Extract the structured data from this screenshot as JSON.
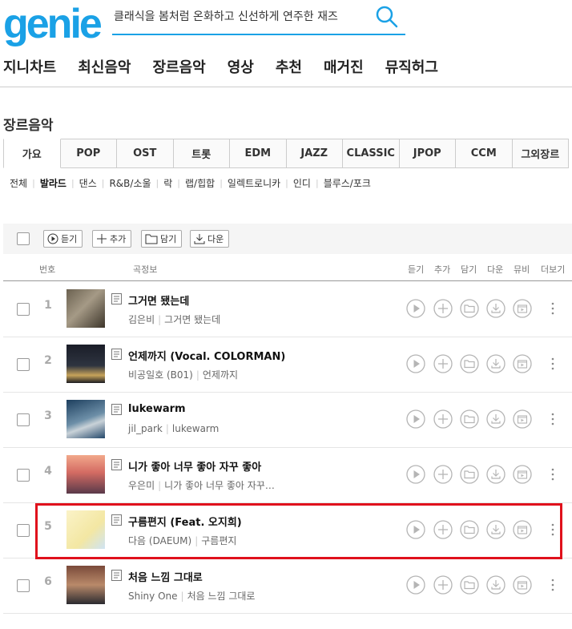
{
  "logo": "genie",
  "search": {
    "value": "클래식을 봄처럼 온화하고 신선하게 연주한 재즈"
  },
  "gnb": [
    "지니차트",
    "최신음악",
    "장르음악",
    "영상",
    "추천",
    "매거진",
    "뮤직허그"
  ],
  "section_title": "장르음악",
  "genre_tabs": [
    "가요",
    "POP",
    "OST",
    "트롯",
    "EDM",
    "JAZZ",
    "CLASSIC",
    "JPOP",
    "CCM",
    "그외장르"
  ],
  "active_tab": "가요",
  "sub_genres": [
    "전체",
    "발라드",
    "댄스",
    "R&B/소울",
    "락",
    "랩/힙합",
    "일렉트로니카",
    "인디",
    "블루스/포크"
  ],
  "active_sub": "발라드",
  "toolbar": {
    "listen": "듣기",
    "add": "추가",
    "save": "담기",
    "download": "다운"
  },
  "columns": {
    "no": "번호",
    "info": "곡정보",
    "listen": "듣기",
    "add": "추가",
    "save": "담기",
    "download": "다운",
    "mv": "뮤비",
    "more": "더보기"
  },
  "songs": [
    {
      "no": "1",
      "title": "그거면 됐는데",
      "artist": "김은비",
      "album": "그거면 됐는데"
    },
    {
      "no": "2",
      "title": "언제까지 (Vocal. COLORMAN)",
      "artist": "비공일호 (B01)",
      "album": "언제까지"
    },
    {
      "no": "3",
      "title": "lukewarm",
      "artist": "jil_park",
      "album": "lukewarm"
    },
    {
      "no": "4",
      "title": "니가 좋아 너무 좋아 자꾸 좋아",
      "artist": "우은미",
      "album": "니가 좋아 너무 좋아 자꾸…"
    },
    {
      "no": "5",
      "title": "구름편지 (Feat. 오지희)",
      "artist": "다음 (DAEUM)",
      "album": "구름편지"
    },
    {
      "no": "6",
      "title": "처음 느낌 그대로",
      "artist": "Shiny One",
      "album": "처음 느낌 그대로"
    }
  ],
  "highlighted_row": "5",
  "colors": {
    "brand": "#1aa1e6",
    "highlight": "#e0111c",
    "icon": "#b5b5b5"
  }
}
